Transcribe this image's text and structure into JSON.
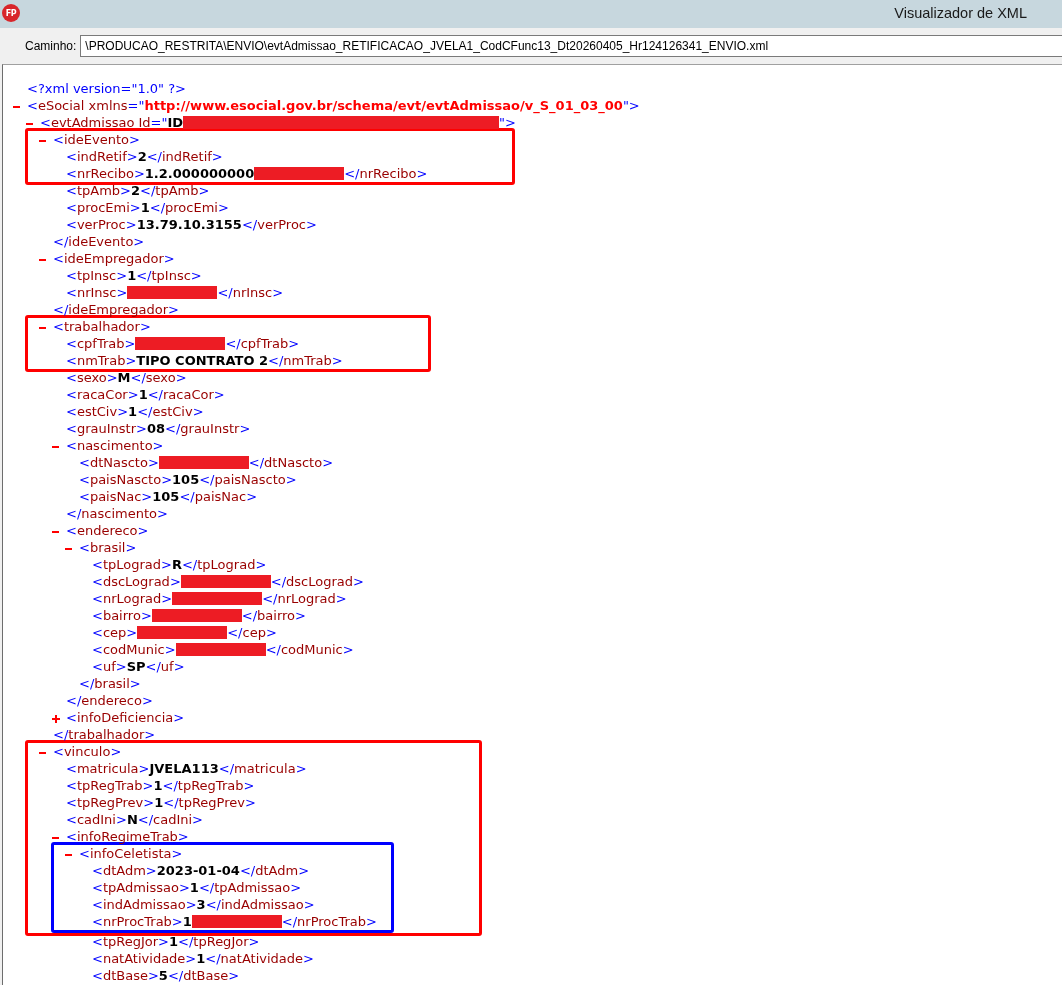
{
  "window": {
    "icon_label": "FP",
    "title": "Visualizador de XML"
  },
  "path_field": {
    "label": "Caminho:",
    "value": "\\PRODUCAO_RESTRITA\\ENVIO\\evtAdmissao_RETIFICACAO_JVELA1_CodCFunc13_Dt20260405_Hr124126341_ENVIO.xml"
  },
  "xml": [
    {
      "kind": "declaration",
      "text": "<?xml version=\"1.0\" ?>"
    },
    {
      "kind": "element",
      "expanded": true,
      "tag_open": "<eSocial xmlns=\"",
      "attribute": {
        "kind": "namespace",
        "value": "http://www.esocial.gov.br/schema/evt/evtAdmissao/v_S_01_03_00"
      },
      "tag_open_end": "\">",
      "children": [
        {
          "kind": "element",
          "expanded": true,
          "tag_open": "<evtAdmissao Id=\"",
          "attribute": {
            "kind": "plain",
            "value": "ID"
          },
          "redacted": true,
          "tag_open_end": "\">",
          "children": [
            {
              "kind": "element",
              "expanded": true,
              "frame_start": {
                "color": "#ff0000"
              },
              "tag_open": "<ideEvento>",
              "children": [
                {
                  "kind": "leaf",
                  "tag_open": "<indRetif>",
                  "value": "2",
                  "tag_close": "</indRetif>"
                },
                {
                  "kind": "leaf",
                  "tag_open": "<nrRecibo>",
                  "value": "1.2.000000000",
                  "redacted": true,
                  "frame_end": true,
                  "tag_close": "</nrRecibo>"
                },
                {
                  "kind": "leaf",
                  "tag_open": "<tpAmb>",
                  "value": "2",
                  "tag_close": "</tpAmb>"
                },
                {
                  "kind": "leaf",
                  "tag_open": "<procEmi>",
                  "value": "1",
                  "tag_close": "</procEmi>"
                },
                {
                  "kind": "leaf",
                  "tag_open": "<verProc>",
                  "value": "13.79.10.3155",
                  "tag_close": "</verProc>"
                }
              ],
              "tag_close": "</ideEvento>"
            },
            {
              "kind": "element",
              "expanded": true,
              "tag_open": "<ideEmpregador>",
              "children": [
                {
                  "kind": "leaf",
                  "tag_open": "<tpInsc>",
                  "value": "1",
                  "tag_close": "</tpInsc>"
                },
                {
                  "kind": "leaf",
                  "tag_open": "<nrInsc>",
                  "redacted": true,
                  "tag_close": "</nrInsc>"
                }
              ],
              "tag_close": "</ideEmpregador>"
            },
            {
              "kind": "element",
              "expanded": true,
              "frame_start": {
                "color": "#ff0000"
              },
              "tag_open": "<trabalhador>",
              "children": [
                {
                  "kind": "leaf",
                  "tag_open": "<cpfTrab>",
                  "redacted": true,
                  "tag_close": "</cpfTrab>"
                },
                {
                  "kind": "leaf",
                  "tag_open": "<nmTrab>",
                  "value": "TIPO CONTRATO 2",
                  "frame_end": true,
                  "tag_close": "</nmTrab>"
                },
                {
                  "kind": "leaf",
                  "tag_open": "<sexo>",
                  "value": "M",
                  "tag_close": "</sexo>"
                },
                {
                  "kind": "leaf",
                  "tag_open": "<racaCor>",
                  "value": "1",
                  "tag_close": "</racaCor>"
                },
                {
                  "kind": "leaf",
                  "tag_open": "<estCiv>",
                  "value": "1",
                  "tag_close": "</estCiv>"
                },
                {
                  "kind": "leaf",
                  "tag_open": "<grauInstr>",
                  "value": "08",
                  "tag_close": "</grauInstr>"
                },
                {
                  "kind": "element",
                  "expanded": true,
                  "tag_open": "<nascimento>",
                  "children": [
                    {
                      "kind": "leaf",
                      "tag_open": "<dtNascto>",
                      "redacted": true,
                      "tag_close": "</dtNascto>"
                    },
                    {
                      "kind": "leaf",
                      "tag_open": "<paisNascto>",
                      "value": "105",
                      "tag_close": "</paisNascto>"
                    },
                    {
                      "kind": "leaf",
                      "tag_open": "<paisNac>",
                      "value": "105",
                      "tag_close": "</paisNac>"
                    }
                  ],
                  "tag_close": "</nascimento>"
                },
                {
                  "kind": "element",
                  "expanded": true,
                  "tag_open": "<endereco>",
                  "children": [
                    {
                      "kind": "element",
                      "expanded": true,
                      "tag_open": "<brasil>",
                      "children": [
                        {
                          "kind": "leaf",
                          "tag_open": "<tpLograd>",
                          "value": "R",
                          "tag_close": "</tpLograd>"
                        },
                        {
                          "kind": "leaf",
                          "tag_open": "<dscLograd>",
                          "redacted": true,
                          "tag_close": "</dscLograd>"
                        },
                        {
                          "kind": "leaf",
                          "tag_open": "<nrLograd>",
                          "redacted": true,
                          "tag_close": "</nrLograd>"
                        },
                        {
                          "kind": "leaf",
                          "tag_open": "<bairro>",
                          "redacted": true,
                          "tag_close": "</bairro>"
                        },
                        {
                          "kind": "leaf",
                          "tag_open": "<cep>",
                          "redacted": true,
                          "tag_close": "</cep>"
                        },
                        {
                          "kind": "leaf",
                          "tag_open": "<codMunic>",
                          "redacted": true,
                          "tag_close": "</codMunic>"
                        },
                        {
                          "kind": "leaf",
                          "tag_open": "<uf>",
                          "value": "SP",
                          "tag_close": "</uf>"
                        }
                      ],
                      "tag_close": "</brasil>"
                    }
                  ],
                  "tag_close": "</endereco>"
                },
                {
                  "kind": "element",
                  "expanded": false,
                  "tag_open": "<infoDeficiencia>"
                }
              ],
              "tag_close": "</trabalhador>"
            },
            {
              "kind": "element",
              "expanded": true,
              "frame_start": {
                "color": "#ff0000"
              },
              "tag_open": "<vinculo>",
              "children": [
                {
                  "kind": "leaf",
                  "tag_open": "<matricula>",
                  "value": "JVELA113",
                  "tag_close": "</matricula>"
                },
                {
                  "kind": "leaf",
                  "tag_open": "<tpRegTrab>",
                  "value": "1",
                  "tag_close": "</tpRegTrab>"
                },
                {
                  "kind": "leaf",
                  "tag_open": "<tpRegPrev>",
                  "value": "1",
                  "tag_close": "</tpRegPrev>"
                },
                {
                  "kind": "leaf",
                  "tag_open": "<cadIni>",
                  "value": "N",
                  "tag_close": "</cadIni>"
                },
                {
                  "kind": "element",
                  "expanded": true,
                  "tag_open": "<infoRegimeTrab>",
                  "children": [
                    {
                      "kind": "element",
                      "expanded": true,
                      "frame_start": {
                        "color": "#0000ff"
                      },
                      "tag_open": "<infoCeletista>",
                      "children": [
                        {
                          "kind": "leaf",
                          "tag_open": "<dtAdm>",
                          "value": "2023-01-04",
                          "tag_close": "</dtAdm>"
                        },
                        {
                          "kind": "leaf",
                          "tag_open": "<tpAdmissao>",
                          "value": "1",
                          "tag_close": "</tpAdmissao>"
                        },
                        {
                          "kind": "leaf",
                          "tag_open": "<indAdmissao>",
                          "value": "3",
                          "tag_close": "</indAdmissao>"
                        },
                        {
                          "kind": "leaf",
                          "tag_open": "<nrProcTrab>",
                          "value": "1",
                          "redacted": true,
                          "frame_end": true,
                          "tag_close": "</nrProcTrab>"
                        },
                        {
                          "kind": "leaf",
                          "tag_open": "<tpRegJor>",
                          "value": "1",
                          "tag_close": "</tpRegJor>"
                        },
                        {
                          "kind": "leaf",
                          "tag_open": "<natAtividade>",
                          "value": "1",
                          "tag_close": "</natAtividade>"
                        },
                        {
                          "kind": "leaf",
                          "tag_open": "<dtBase>",
                          "value": "5",
                          "tag_close": "</dtBase>"
                        }
                      ]
                    }
                  ]
                }
              ]
            }
          ]
        }
      ]
    }
  ]
}
